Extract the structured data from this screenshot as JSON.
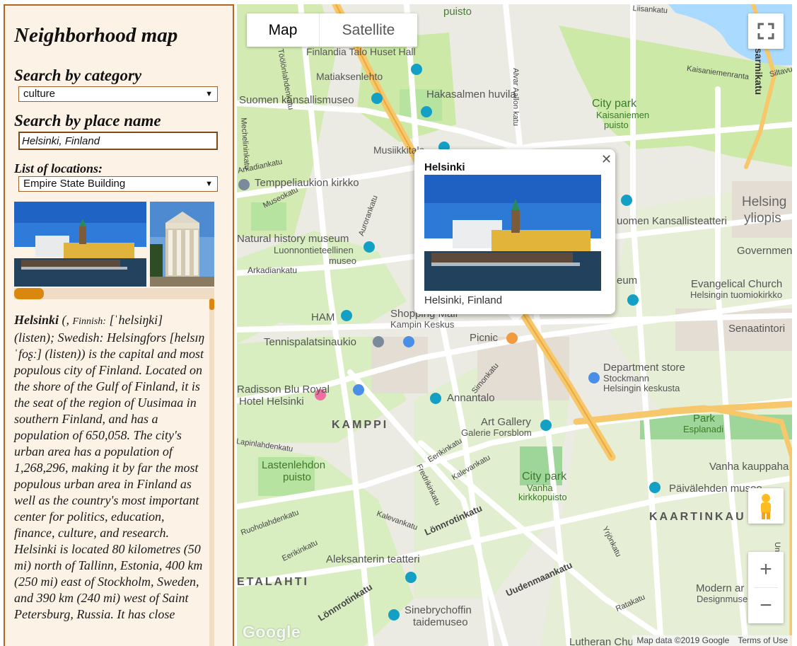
{
  "sidebar": {
    "title": "Neighborhood map",
    "category_heading": "Search by category",
    "category_value": "culture",
    "place_heading": "Search by place name",
    "place_value": "Helsinki, Finland",
    "locations_heading": "List of locations:",
    "locations_value": "Empire State Building",
    "description": {
      "name": "Helsinki",
      "lead": " (, ",
      "finnish_label": "Finnish:",
      "body": " [ˈhelsiŋki] (listen); Swedish: Helsingfors [helsɪŋˈfoʂː] (listen)) is the capital and most populous city of Finland. Located on the shore of the Gulf of Finland, it is the seat of the region of Uusimaa in southern Finland, and has a population of 650,058. The city's urban area has a population of 1,268,296, making it by far the most populous urban area in Finland as well as the country's most important center for politics, education, finance, culture, and research. Helsinki is located 80 kilometres (50 mi) north of Tallinn, Estonia, 400 km (250 mi) east of Stockholm, Sweden, and 390 km (240 mi) west of Saint Petersburg, Russia. It has close"
    }
  },
  "map": {
    "type_controls": {
      "map": "Map",
      "satellite": "Satellite"
    },
    "info_window": {
      "title": "Helsinki",
      "caption": "Helsinki, Finland"
    },
    "zoom_in": "+",
    "zoom_out": "−",
    "logo": "Google",
    "attribution": "Map data ©2019 Google",
    "terms": "Terms of Use",
    "labels": {
      "l01": "puisto",
      "l02": "Finlandia Talo Huset Hall",
      "l03": "Matiaksenlehto",
      "l04": "Hakasalmen huvila",
      "l05": "Suomen kansallismuseo",
      "l06": "City park",
      "l07": "Kaisaniemen",
      "l08": "puisto",
      "l09": "Musiikkitalo",
      "l10": "Temppeliaukion kirkko",
      "l11": "Natural history museum",
      "l12": "Luonnontieteellinen",
      "l13": "museo",
      "l14": "Arkadiankatu",
      "l15": "Helsing",
      "l16": "yliopis",
      "l17": "uomen Kansallisteatteri",
      "l18": "Government",
      "l19": "eum",
      "l20": "Evangelical Church",
      "l21": "Helsingin tuomiokirkko",
      "l22": "HAM",
      "l23": "Shopping Mall",
      "l24": "Kampin Keskus",
      "l25": "Tennispalatsinaukio",
      "l26": "Picnic",
      "l27": "Senaatintori",
      "l28": "Department store",
      "l29": "Stockmann",
      "l30": "Helsingin keskusta",
      "l31": "Radisson Blu Royal",
      "l32": "Hotel Helsinki",
      "l33": "Annantalo",
      "l34": "KAMPPI",
      "l35": "Art Gallery",
      "l36": "Galerie Forsblom",
      "l37": "Park",
      "l38": "Esplanadi",
      "l39": "Lastenlehdon",
      "l40": "puisto",
      "l41": "City park",
      "l42": "Vanha",
      "l43": "kirkkopuisto",
      "l44": "Vanha kauppaha",
      "l45": "Päivälehden museo",
      "l46": "KAARTINKAU",
      "l47": "Aleksanterin teatteri",
      "l48": "Lönnrotinkatu",
      "l49": "Uudenmaankatu",
      "l50": "ETALAHTI",
      "l51": "Lönnrotinkatu",
      "l52": "Sinebrychoffin",
      "l53": "taidemuseo",
      "l54": "Modern ar",
      "l55": "Designmuse",
      "l56": "Kaisaniemenranta",
      "l57": "Töölönlahdenkatu",
      "l58": "Alvar Aallon katu",
      "l59": "Aurorankatu",
      "l60": "Kalevankatu",
      "l61": "Eerikinkatu",
      "l62": "Fredrikinkatu",
      "l63": "Yrjönkatu",
      "l64": "Ratakatu",
      "l65": "Lutheran Chu",
      "l66": "Siltavuo",
      "l67": "Mechelininkatu",
      "l68": "Lapinlahdenkatu",
      "l69": "Ruoholahdenkatu",
      "l70": "Kalevankatu",
      "l71": "Eerikinkatu",
      "l72": "Museokatu",
      "l73": "Liisankatu",
      "l74": "Unioninkatu",
      "l75": "Simonkatu",
      "l76": "Kasarmikatu",
      "l77": "Arkadiankatu"
    }
  },
  "colors": {
    "sidebar_bg": "#fdf2e6",
    "sidebar_border": "#b8661f",
    "scroll_accent": "#d9870e",
    "map_base": "#ecebe3",
    "park": "#cde9a8",
    "road": "#ffffff",
    "major_road": "#f7c86b",
    "water": "#aadaff"
  }
}
